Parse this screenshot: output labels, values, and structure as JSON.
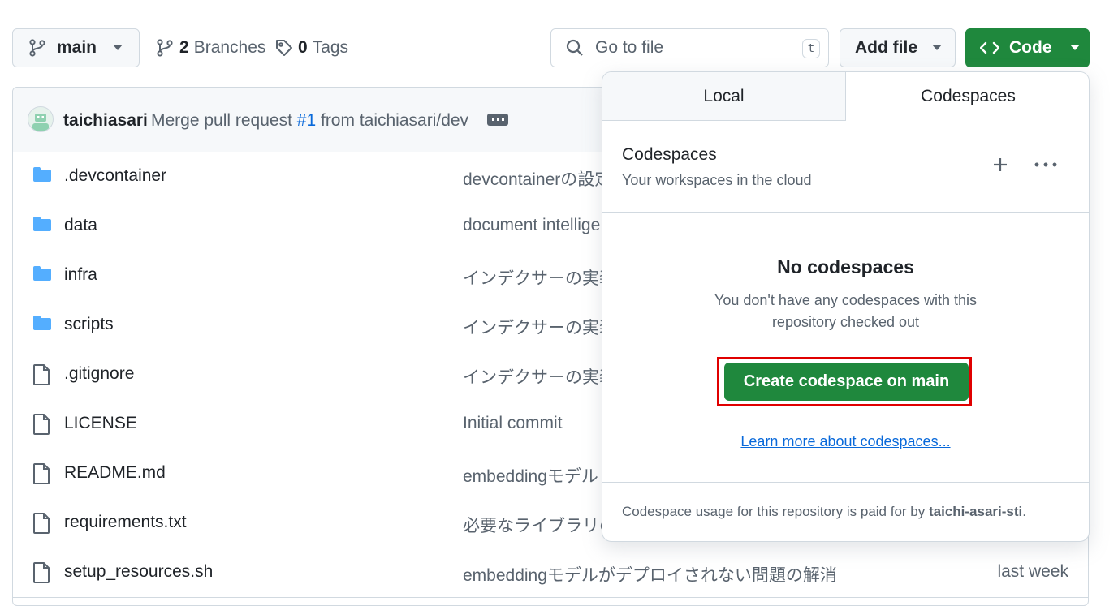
{
  "toolbar": {
    "branch": "main",
    "branches_count": "2",
    "branches_label": "Branches",
    "tags_count": "0",
    "tags_label": "Tags",
    "search_placeholder": "Go to file",
    "search_shortcut": "t",
    "add_file_label": "Add file",
    "code_label": "Code"
  },
  "commit": {
    "author": "taichiasari",
    "message_prefix": "Merge pull request",
    "pr_link": "#1",
    "message_suffix": "from taichiasari/dev"
  },
  "files": [
    {
      "name": ".devcontainer",
      "type": "folder",
      "message": "devcontainerの設定",
      "time": ""
    },
    {
      "name": "data",
      "type": "folder",
      "message": "document intellige",
      "time": ""
    },
    {
      "name": "infra",
      "type": "folder",
      "message": "インデクサーの実装",
      "time": ""
    },
    {
      "name": "scripts",
      "type": "folder",
      "message": "インデクサーの実装",
      "time": ""
    },
    {
      "name": ".gitignore",
      "type": "file",
      "message": "インデクサーの実装",
      "time": ""
    },
    {
      "name": "LICENSE",
      "type": "file",
      "message": "Initial commit",
      "time": ""
    },
    {
      "name": "README.md",
      "type": "file",
      "message": "embeddingモデル",
      "time": ""
    },
    {
      "name": "requirements.txt",
      "type": "file",
      "message": "必要なライブラリの",
      "time": ""
    },
    {
      "name": "setup_resources.sh",
      "type": "file",
      "message": "embeddingモデルがデプロイされない問題の解消",
      "time": "last week"
    }
  ],
  "panel": {
    "tab_local": "Local",
    "tab_codespaces": "Codespaces",
    "section_title": "Codespaces",
    "section_subtitle": "Your workspaces in the cloud",
    "empty_title": "No codespaces",
    "empty_desc_line1": "You don't have any codespaces with this",
    "empty_desc_line2": "repository checked out",
    "create_button": "Create codespace on main",
    "learn_more": "Learn more about codespaces...",
    "footer_prefix": "Codespace usage for this repository is paid for by",
    "footer_owner": "taichi-asari-sti",
    "footer_suffix": "."
  },
  "colors": {
    "green": "#1f883d",
    "folder": "#54aeff",
    "link": "#0969da",
    "highlight": "#e00000"
  }
}
